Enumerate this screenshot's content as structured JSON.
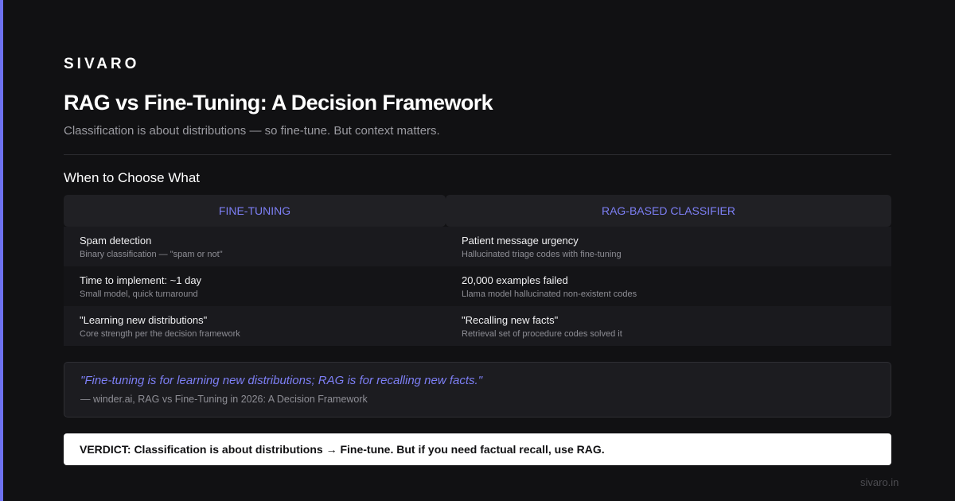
{
  "brand": "SIVARO",
  "title": "RAG vs Fine-Tuning: A Decision Framework",
  "subtitle": "Classification is about distributions — so fine-tune. But context matters.",
  "section_heading": "When to Choose What",
  "table": {
    "headers": [
      "FINE-TUNING",
      "RAG-BASED CLASSIFIER"
    ],
    "rows": [
      {
        "left": {
          "title": "Spam detection",
          "sub": "Binary classification — \"spam or not\""
        },
        "right": {
          "title": "Patient message urgency",
          "sub": "Hallucinated triage codes with fine-tuning"
        }
      },
      {
        "left": {
          "title": "Time to implement: ~1 day",
          "sub": "Small model, quick turnaround"
        },
        "right": {
          "title": "20,000 examples failed",
          "sub": "Llama model hallucinated non-existent codes"
        }
      },
      {
        "left": {
          "title": "\"Learning new distributions\"",
          "sub": "Core strength per the decision framework"
        },
        "right": {
          "title": "\"Recalling new facts\"",
          "sub": "Retrieval set of procedure codes solved it"
        }
      }
    ]
  },
  "quote": {
    "text": "\"Fine-tuning is for learning new distributions; RAG is for recalling new facts.\"",
    "source": "— winder.ai, RAG vs Fine-Tuning in 2026: A Decision Framework"
  },
  "verdict": "VERDICT: Classification is about distributions → Fine-tune. But if you need factual recall, use RAG.",
  "footer": "sivaro.in",
  "colors": {
    "background": "#111113",
    "accent": "#6e72f0",
    "header_text": "#7d7ff5"
  }
}
